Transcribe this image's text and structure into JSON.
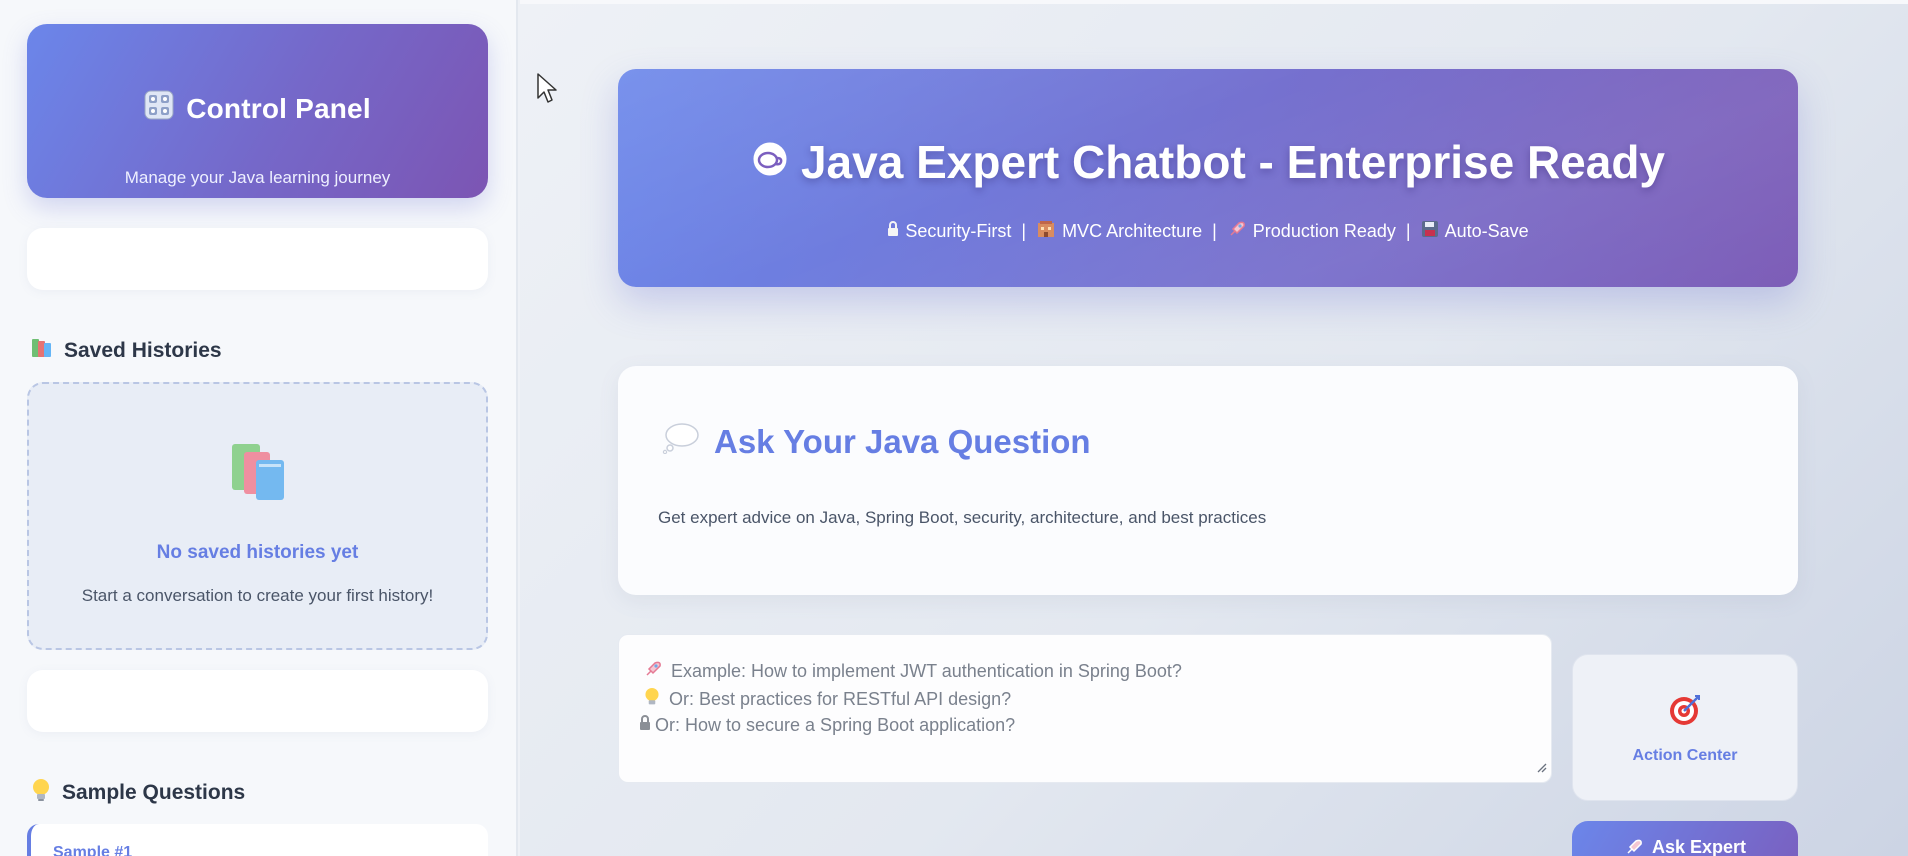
{
  "sidebar": {
    "control_panel": {
      "title": "Control Panel",
      "subtitle": "Manage your Java learning journey",
      "icon": "control-knobs-icon"
    },
    "saved_histories": {
      "heading": "Saved Histories",
      "icon": "books-icon",
      "empty_title": "No saved histories yet",
      "empty_subtitle": "Start a conversation to create your first history!"
    },
    "sample_questions": {
      "heading": "Sample Questions",
      "icon": "lightbulb-icon",
      "first_item_label": "Sample #1"
    }
  },
  "hero": {
    "icon": "coffee-cup-icon",
    "title": "Java Expert Chatbot - Enterprise Ready",
    "tags": [
      {
        "icon": "lock-icon",
        "label": "Security-First"
      },
      {
        "icon": "building-icon",
        "label": "MVC Architecture"
      },
      {
        "icon": "rocket-icon",
        "label": "Production Ready"
      },
      {
        "icon": "floppy-disk-icon",
        "label": "Auto-Save"
      }
    ],
    "separator": "|"
  },
  "ask": {
    "icon": "thought-bubble-icon",
    "title": "Ask Your Java Question",
    "subtitle": "Get expert advice on Java, Spring Boot, security, architecture, and best practices",
    "placeholder_lines": [
      "Example: How to implement JWT authentication in Spring Boot?",
      "Or: Best practices for RESTful API design?",
      "Or: How to secure a Spring Boot application?"
    ]
  },
  "actions": {
    "action_center_label": "Action Center",
    "action_center_icon": "target-icon",
    "ask_button_label": "Ask Expert",
    "ask_button_icon": "rocket-icon"
  },
  "colors": {
    "brand_start": "#6b86ea",
    "brand_end": "#7c55b3",
    "accent_text": "#667ee3"
  }
}
